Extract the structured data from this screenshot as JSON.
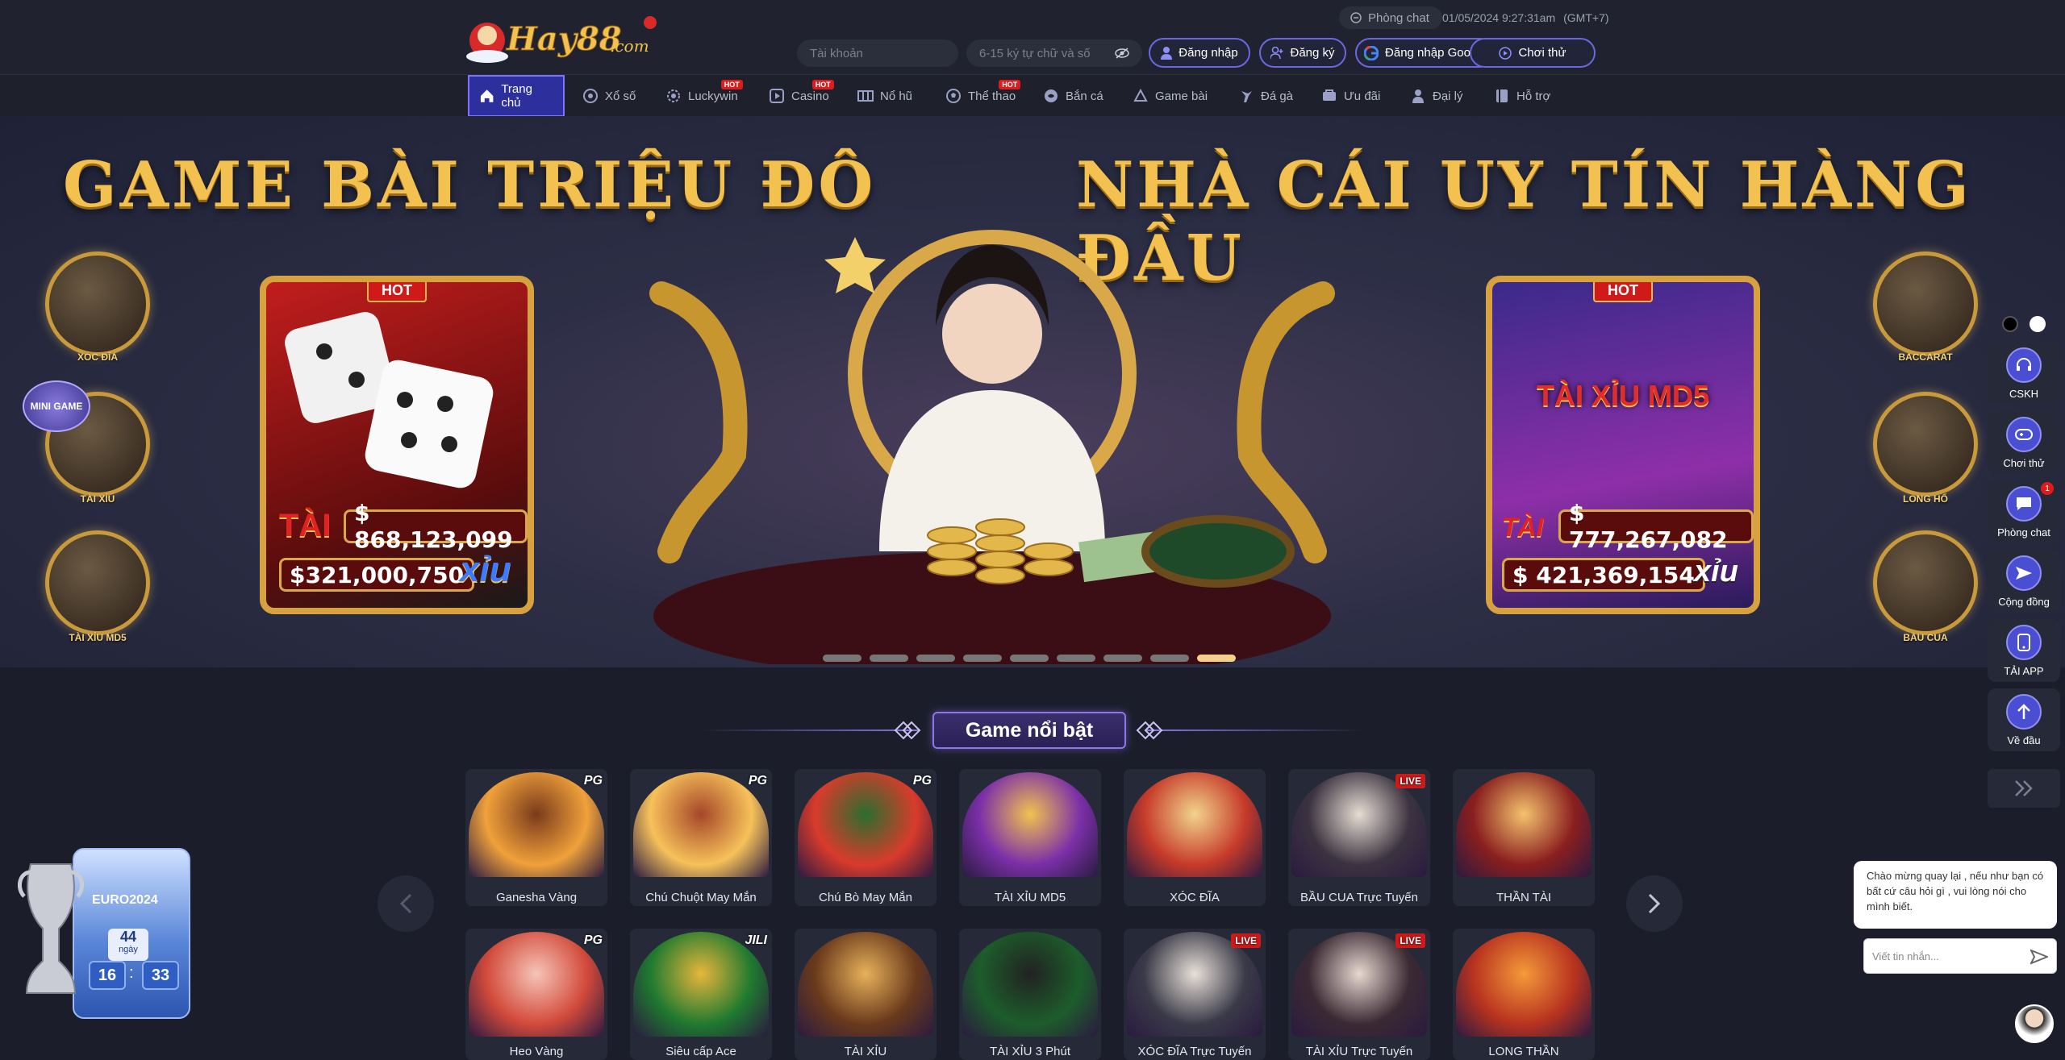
{
  "header": {
    "logo_text": "Hay88.com",
    "chat_room_label": "Phòng chat",
    "date": "01/05/2024 9:27:31am",
    "timezone": "(GMT+7)",
    "account_placeholder": "Tài khoản",
    "password_placeholder": "6-15 ký tự chữ và số",
    "login_label": "Đăng nhập",
    "register_label": "Đăng ký",
    "google_login_label": "Đăng nhập Google",
    "trial_label": "Chơi thử"
  },
  "nav": {
    "items": [
      {
        "label": "Trang chủ"
      },
      {
        "label": "Xổ số"
      },
      {
        "label": "Luckywin",
        "badge": "HOT"
      },
      {
        "label": "Casino",
        "badge": "HOT"
      },
      {
        "label": "Nổ hũ"
      },
      {
        "label": "Thể thao",
        "badge": "HOT"
      },
      {
        "label": "Bắn cá"
      },
      {
        "label": "Game bài"
      },
      {
        "label": "Đá gà"
      },
      {
        "label": "Ưu đãi"
      },
      {
        "label": "Đại lý"
      },
      {
        "label": "Hỗ trợ"
      }
    ]
  },
  "banner": {
    "title_left": "GAME BÀI TRIỆU ĐÔ",
    "title_right": "NHÀ CÁI UY TÍN HÀNG ĐẦU",
    "left_games": [
      "XÓC ĐĨA",
      "TÀI XỈU",
      "TÀI XỈU MD5"
    ],
    "right_games": [
      "BACCARAT",
      "LONG HỔ",
      "BẦU CUA"
    ],
    "card_left": {
      "badge": "HOT",
      "tai_label": "TÀI",
      "xiu_label": "xỉu",
      "tai_value": "$ 868,123,099",
      "xiu_value": "$321,000,750"
    },
    "card_right": {
      "badge": "HOT",
      "game_title": "TÀI XỈU MD5",
      "tai_label": "TÀI",
      "xiu_label": "xỉu",
      "tai_value": "$ 777,267,082",
      "xiu_value": "$ 421,369,154"
    },
    "mini_game_label": "MINI GAME",
    "active_slide": 9,
    "slide_count": 9
  },
  "featured": {
    "title": "Game nổi bật",
    "games_row1": [
      {
        "name": "Ganesha Vàng",
        "tag": "PG"
      },
      {
        "name": "Chú Chuột May Mắn",
        "tag": "PG"
      },
      {
        "name": "Chú Bò May Mắn",
        "tag": "PG"
      },
      {
        "name": "TÀI XỈU MD5",
        "tag": ""
      },
      {
        "name": "XÓC ĐĨA",
        "tag": ""
      },
      {
        "name": "BẦU CUA Trực Tuyến",
        "tag": "LIVE"
      },
      {
        "name": "THẦN TÀI",
        "tag": ""
      }
    ],
    "games_row2": [
      {
        "name": "Heo Vàng",
        "tag": "PG"
      },
      {
        "name": "Siêu cấp Ace",
        "tag": "JILI"
      },
      {
        "name": "TÀI XỈU",
        "tag": ""
      },
      {
        "name": "TÀI XỈU 3 Phút",
        "tag": ""
      },
      {
        "name": "XÓC ĐĨA Trực Tuyến",
        "tag": "LIVE"
      },
      {
        "name": "TÀI XỈU Trực Tuyến",
        "tag": "LIVE"
      },
      {
        "name": "LONG THẦN",
        "tag": ""
      }
    ]
  },
  "right_rail": {
    "items": [
      {
        "label": "CSKH"
      },
      {
        "label": "Chơi thử"
      },
      {
        "label": "Phòng chat",
        "badge": "1"
      },
      {
        "label": "Cộng đồng"
      },
      {
        "label": "TẢI APP"
      },
      {
        "label": "Về đầu"
      }
    ]
  },
  "chat_widget": {
    "message": "Chào mừng quay lại , nếu như bạn có bất cứ câu hỏi gì , vui lòng nói cho mình biết.",
    "input_placeholder": "Viết tin nhắn..."
  },
  "euro_widget": {
    "title": "EURO2024",
    "days": "44",
    "days_label": "ngày",
    "hours": "16",
    "minutes": "33"
  },
  "colors": {
    "accent": "#6a68e0",
    "gold": "#f2c14f",
    "background": "#1b1e2a",
    "hot_red": "#e01b1b"
  }
}
